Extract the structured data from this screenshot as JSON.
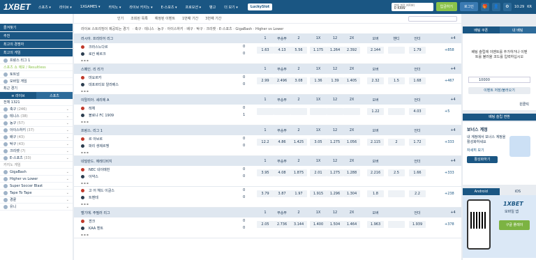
{
  "header": {
    "logo": "1XBET",
    "nav": [
      "스포츠 ▾",
      "라이브 ▾",
      "1XGAMES ▾",
      "카지노 ▾",
      "라이브 카지노 ▾",
      "E-스포츠 ▾",
      "프로모션 ▾",
      "뱅고",
      "더 보기 ▾"
    ],
    "lucky": "LuckySlot",
    "phone_label": "판매 계정 (KRW)",
    "phone_value": "0 KRW",
    "login": "로그인",
    "deposit": "입금하기",
    "register": "회원가입",
    "time": "10:29",
    "lang": "KR"
  },
  "subnav": [
    "인기",
    "조회된 목록",
    "예정된 이벤트",
    "1번째 기간",
    "3번째 기간"
  ],
  "left": {
    "head1": "즐겨찾기",
    "fav": "추천",
    "fav_items": [
      "최고의 경쟁자",
      "최고의 게임"
    ],
    "game": "프랑스 리그 1",
    "game2": "스포츠 쇼 에보 / Resultless",
    "score_line": [
      "토트넘 ",
      "모바일 게임"
    ],
    "hist": "최근 경기",
    "tabs": [
      "≡ 라이브",
      "스포츠"
    ],
    "count": "전체 1321",
    "sports": [
      {
        "name": "축구",
        "n": "(246)"
      },
      {
        "name": "테니스",
        "n": "(38)"
      },
      {
        "name": "농구",
        "n": "(57)"
      },
      {
        "name": "아이스하키",
        "n": "(37)"
      },
      {
        "name": "배구",
        "n": "(43)"
      },
      {
        "name": "탁구",
        "n": "(43)"
      },
      {
        "name": "크리켓",
        "n": "(7)"
      },
      {
        "name": "E-스포츠",
        "n": "(33)"
      }
    ],
    "casino_title": "카지노 게임",
    "games": [
      "GigaBash",
      "Higher vs Lower",
      "Super Soccer Blast",
      "Tape To Tape",
      "경륜",
      "유니"
    ]
  },
  "leagues": [
    {
      "name": "러시아. 프리미어 리그",
      "cols": [
        "1",
        "무승부",
        "2",
        "1X",
        "12",
        "2X",
        "오버",
        "핸디",
        "언더",
        "+4"
      ],
      "matches": [
        {
          "t1": "크라스노다르",
          "t2": "로칸 베르크",
          "s1": "0",
          "s2": "0",
          "odds": [
            "1.63",
            "4.13",
            "5.56",
            "1.175",
            "1.264",
            "2.392",
            "2.144",
            "",
            "1.79"
          ],
          "more": "+858"
        }
      ]
    },
    {
      "name": "스페인. 리 리가",
      "cols": [
        "1",
        "무승부",
        "2",
        "1X",
        "12",
        "2X",
        "오버",
        "",
        "언더",
        "+4"
      ],
      "matches": [
        {
          "t1": "마요르카",
          "t2": "데포르티보 알라베스",
          "s1": "0",
          "s2": "0",
          "odds": [
            "2.99",
            "2.496",
            "3.08",
            "1.36",
            "1.39",
            "1.405",
            "2.32",
            "1.5",
            "1.68"
          ],
          "more": "+467"
        }
      ]
    },
    {
      "name": "이탈리아. 세리에 A",
      "cols": [
        "1",
        "무승부",
        "2",
        "1X",
        "12",
        "2X",
        "오버",
        "",
        "언더",
        "+4"
      ],
      "matches": [
        {
          "t1": "레체",
          "t2": "볼로냐 FC 1909",
          "s1": "0",
          "s2": "1",
          "odds": [
            "",
            "",
            "",
            "",
            "",
            "",
            "1.22",
            "",
            "4.03"
          ],
          "more": "+5"
        }
      ]
    },
    {
      "name": "프랑스. 리그 1",
      "cols": [
        "1",
        "무승부",
        "2",
        "1X",
        "12",
        "2X",
        "오버",
        "",
        "언더",
        "+4"
      ],
      "matches": [
        {
          "t1": "르 아브르",
          "t2": "파리 생제르맹",
          "s1": "0",
          "s2": "0",
          "odds": [
            "12.2",
            "4.86",
            "1.425",
            "3.05",
            "1.275",
            "1.056",
            "2.115",
            "2",
            "1.72"
          ],
          "more": "+333"
        }
      ]
    },
    {
      "name": "네덜란드. 에레디비지",
      "cols": [
        "1",
        "무승부",
        "2",
        "1X",
        "12",
        "2X",
        "오버",
        "",
        "언더",
        "+4"
      ],
      "matches": [
        {
          "t1": "NEC 네이메헌",
          "t2": "아약스",
          "s1": "0",
          "s2": "0",
          "odds": [
            "3.95",
            "4.08",
            "1.875",
            "2.01",
            "1.275",
            "1.288",
            "2.216",
            "2.5",
            "1.66"
          ],
          "more": "+333"
        },
        {
          "t1": "고 어 헤드 이글스",
          "t2": "트벤테",
          "s1": "0",
          "s2": "0",
          "odds": [
            "3.79",
            "3.87",
            "1.97",
            "1.915",
            "1.296",
            "1.304",
            "1.8",
            "",
            "2.2"
          ],
          "more": "+238"
        }
      ]
    },
    {
      "name": "벨기에. 주필러 리그",
      "cols": [
        "1",
        "무승부",
        "2",
        "1X",
        "12",
        "2X",
        "오버",
        "",
        "언더",
        "+4"
      ],
      "matches": [
        {
          "t1": "겐크",
          "t2": "KAA 헨트",
          "s1": "0",
          "s2": "0",
          "odds": [
            "2.05",
            "2.736",
            "3.144",
            "1.400",
            "1.504",
            "1.464",
            "1.963",
            "",
            "1.939"
          ],
          "more": "+378"
        }
      ]
    }
  ],
  "right": {
    "tabs": [
      "배팅 쿠폰",
      "내 배팅"
    ],
    "empty": "베팅 슬립에 이벤트를 추가하거나 이벤트를 불러올 코드를 입력하십시오",
    "amount": "10000",
    "auto": "원클릭",
    "save": "이벤트 저장/불러오기",
    "bonus_title": "보너스 계정",
    "bonus_text": "내 계정에서 보너스 계정을 활성화하세요",
    "more": "자세히 보기",
    "activate": "활성화하기",
    "exchange": "배팅 슬립 변환",
    "app_tabs": [
      "Android",
      "iOS"
    ],
    "app_brand": "1XBET",
    "app_sub": "모바일 앱",
    "get_it": "구글 플레이"
  }
}
